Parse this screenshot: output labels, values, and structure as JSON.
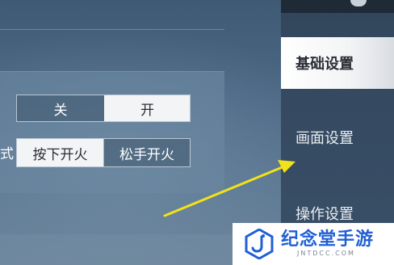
{
  "screen": {
    "title_hidden": ""
  },
  "toggle_row": {
    "off_label": "关",
    "on_label": "开",
    "selected": "开"
  },
  "fire_mode": {
    "label_fragment": "式",
    "press_label": "按下开火",
    "release_label": "松手开火",
    "selected": "按下开火"
  },
  "sidebar": {
    "items": [
      {
        "label": "基础设置",
        "active": true
      },
      {
        "label": "画面设置",
        "active": false
      },
      {
        "label": "操作设置",
        "active": false
      }
    ]
  },
  "annotation": {
    "arrow_color": "#f2e21a"
  },
  "watermark": {
    "title": "纪念堂手游",
    "subtitle": "JNTDCC.COM",
    "brand_color": "#1f5fd6"
  }
}
